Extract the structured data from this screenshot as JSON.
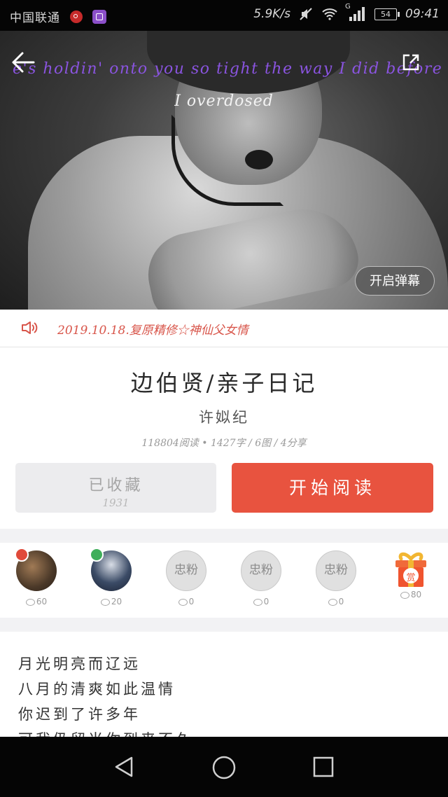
{
  "status_bar": {
    "carrier": "中国联通",
    "net_speed": "5.9K/s",
    "network": "G",
    "battery": "54",
    "time": "09:41"
  },
  "hero": {
    "lyric_line1": "e's holdin' onto you so tight the way I did before",
    "lyric_line2": "I overdosed",
    "danmu_button": "开启弹幕",
    "back_icon": "arrow-left-icon",
    "share_icon": "share-icon"
  },
  "audio": {
    "icon": "speaker-icon",
    "text": "2019.10.18.复原精修☆神仙父女情"
  },
  "book": {
    "title": "边伯贤/亲子日记",
    "author": "许姒纪",
    "stats": "118804阅读 • 1427字 / 6图 / 4分享",
    "favorite_label": "已收藏",
    "favorite_count": "1931",
    "read_label": "开始阅读"
  },
  "fans": [
    {
      "kind": "photo",
      "coins": "60"
    },
    {
      "kind": "photo",
      "coins": "20"
    },
    {
      "kind": "placeholder",
      "label": "忠粉",
      "coins": "0"
    },
    {
      "kind": "placeholder",
      "label": "忠粉",
      "coins": "0"
    },
    {
      "kind": "placeholder",
      "label": "忠粉",
      "coins": "0"
    },
    {
      "kind": "gift",
      "label": "赏",
      "coins": "80"
    }
  ],
  "poem": [
    "月光明亮而辽远",
    "八月的清爽如此温情",
    "你迟到了许多年",
    "可我仍留当你到来不久"
  ],
  "colors": {
    "accent_red": "#e8533f",
    "lyric_purple": "#8a54e0",
    "audio_text": "#d8554a"
  }
}
